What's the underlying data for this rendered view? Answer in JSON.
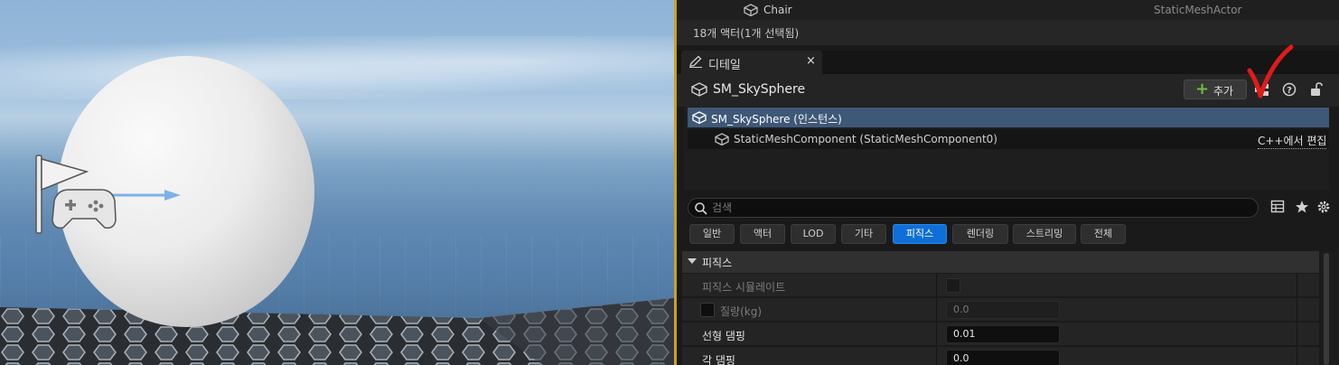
{
  "outliner": {
    "row_label": "Chair",
    "row_type": "StaticMeshActor",
    "actor_count": "18개 액터(1개 선택됨)"
  },
  "details": {
    "tab_title": "디테일",
    "tab_close": "×",
    "actor_name": "SM_SkySphere",
    "add_label": "추가",
    "add_plus": "+",
    "components": {
      "root": "SM_SkySphere (인스턴스)",
      "child": "StaticMeshComponent (StaticMeshComponent0)",
      "edit_cpp": "C++에서 편집"
    },
    "search_placeholder": "검색",
    "filters": [
      "일반",
      "액터",
      "LOD",
      "기타",
      "피직스",
      "렌더링",
      "스트리밍",
      "전체"
    ],
    "active_filter": "피직스",
    "section_title": "피직스",
    "properties": [
      {
        "name": "피직스 시뮬레이트",
        "type": "checkbox",
        "value": ""
      },
      {
        "name": "질량(kg)",
        "type": "number",
        "value": "0.0"
      },
      {
        "name": "선형 댐핑",
        "type": "number",
        "value": "0.01"
      },
      {
        "name": "각 댐핑",
        "type": "number",
        "value": "0.0"
      }
    ]
  },
  "colors": {
    "accent_active": "#0f6fd6",
    "selection": "#3e5877",
    "annotation": "#e01b1b",
    "viewport_border": "#c9a227"
  }
}
